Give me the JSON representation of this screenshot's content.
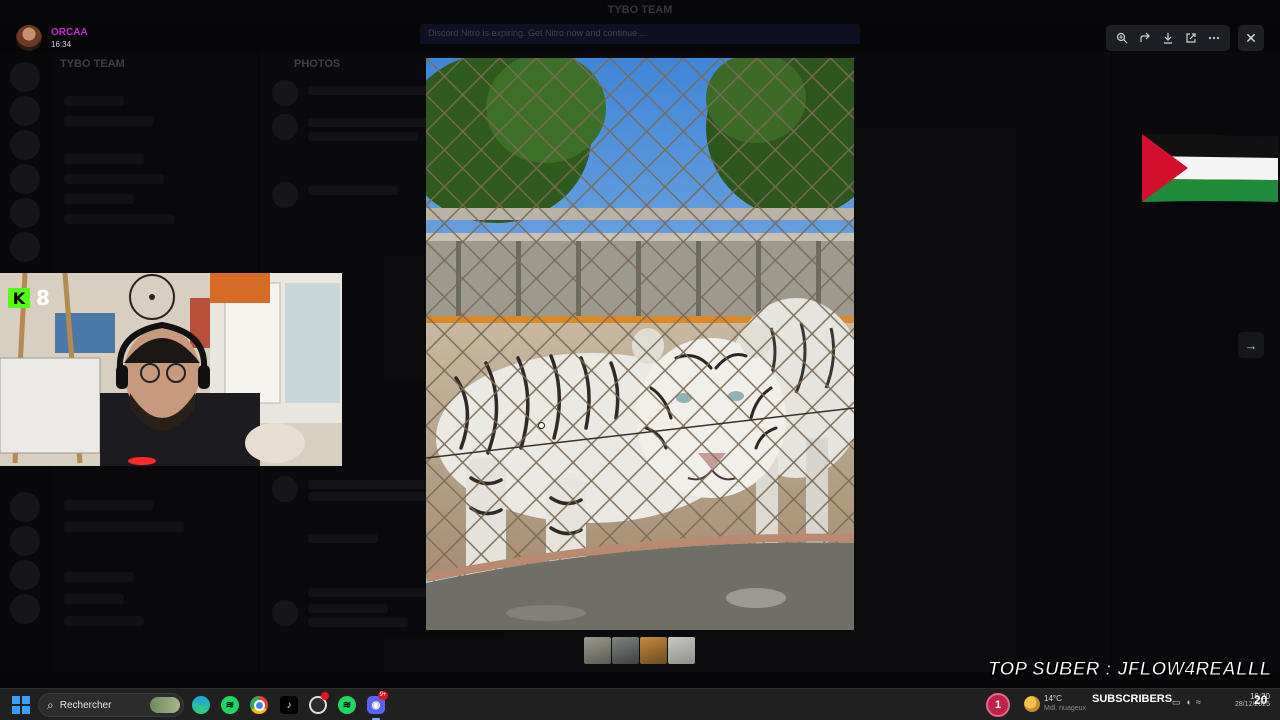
{
  "background": {
    "window_title": "TYBO TEAM",
    "notice": "Discord Nitro is expiring. Get Nitro now and continue ...",
    "server_name": "TYBO TEAM",
    "channel_name": "PHOTOS"
  },
  "viewer": {
    "user": "ORCAA",
    "time": "16:34",
    "tools": [
      {
        "name": "zoom-in-icon",
        "glyph": "⊕"
      },
      {
        "name": "forward-icon",
        "glyph": "↱"
      },
      {
        "name": "download-icon",
        "glyph": "⤓"
      },
      {
        "name": "open-external-icon",
        "glyph": "⧉"
      },
      {
        "name": "more-icon",
        "glyph": "⋯"
      }
    ],
    "close_glyph": "✕",
    "next_glyph": "→",
    "subject": "white tiger behind chain-link fence"
  },
  "overlay": {
    "kick_logo": "K",
    "kick_count": "8",
    "top_suber": "TOP SUBER : JFLOW4REALLL"
  },
  "taskbar": {
    "search_label": "Rechercher",
    "notifications": "1",
    "temperature": "14°C",
    "weather_sub": "Mdl. nuageux",
    "subscribers_label": "SUBSCRIBERS",
    "clock_time": "16:20",
    "clock_date": "28/12/2025",
    "clock_big": "20",
    "discord_badge": "9+"
  },
  "colors": {
    "username": "#c72ccf",
    "kick_green": "#53fc18",
    "accent": "#5865f2"
  }
}
